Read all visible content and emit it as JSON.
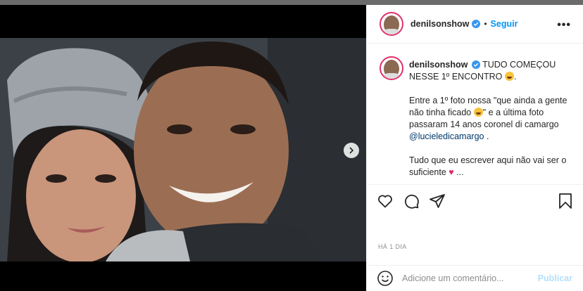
{
  "post": {
    "username": "denilsonshow",
    "follow_label": "Seguir",
    "separator": "•",
    "more_label": "•••",
    "caption": {
      "line1_text": "TUDO COMEÇOU NESSE 1º ENCONTRO",
      "line1_end": ".",
      "para2_part1": "Entre a 1º foto nossa \"que ainda a gente não tinha ficado",
      "para2_part2": "\" e a última foto passaram 14 anos coronel di camargo",
      "mention": "@lucieledicamargo",
      "para2_end": " .",
      "para3_part1": "Tudo que eu escrever aqui não vai ser o suficiente",
      "heart": "♥",
      "para3_end": " ..."
    },
    "timestamp": "HÁ 1 DIA",
    "comment_placeholder": "Adicione um comentário...",
    "publish_label": "Publicar"
  },
  "colors": {
    "accent": "#0095f6",
    "verified": "#3897f0",
    "mention": "#00376b",
    "publish_disabled": "#b2dffc"
  },
  "icons": {
    "next": "chevron-right-icon",
    "verified": "verified-badge-icon",
    "like": "heart-outline-icon",
    "comment": "comment-bubble-icon",
    "share": "paper-plane-icon",
    "save": "bookmark-icon",
    "emoji": "smiley-icon"
  }
}
